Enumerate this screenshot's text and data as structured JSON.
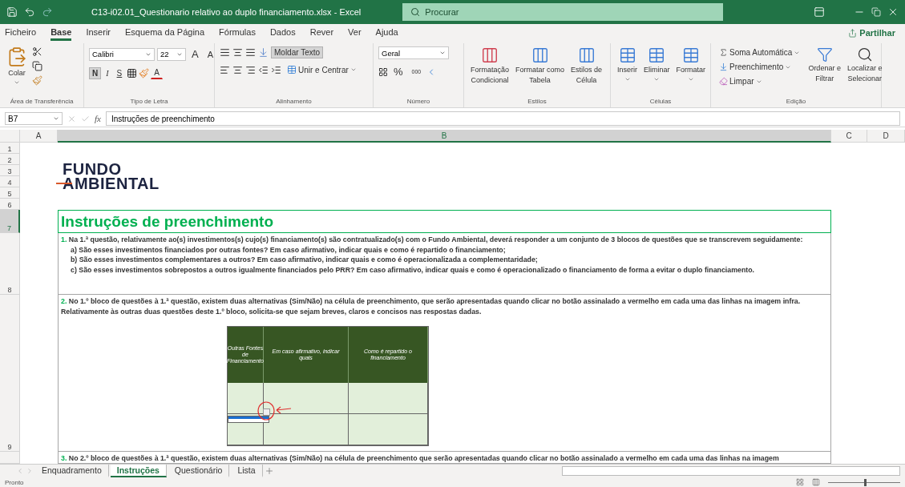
{
  "title_bar": {
    "filename": "C13-i02.01_Questionario relativo ao duplo financiamento.xlsx  -  Excel",
    "search_placeholder": "Procurar"
  },
  "menu_tabs": [
    {
      "label": "Ficheiro",
      "selected": false
    },
    {
      "label": "Base",
      "selected": true
    },
    {
      "label": "Inserir",
      "selected": false
    },
    {
      "label": "Esquema da Página",
      "selected": false
    },
    {
      "label": "Fórmulas",
      "selected": false
    },
    {
      "label": "Dados",
      "selected": false
    },
    {
      "label": "Rever",
      "selected": false
    },
    {
      "label": "Ver",
      "selected": false
    },
    {
      "label": "Ajuda",
      "selected": false
    }
  ],
  "share_button": "Partilhar",
  "ribbon": {
    "clipboard": {
      "paste": "Colar",
      "label": "Área de Transferência"
    },
    "font": {
      "name": "Calibri",
      "size": "22",
      "grow": "A",
      "shrink": "A",
      "bold": "N",
      "italic": "I",
      "underline": "S",
      "color_letter": "A",
      "bold_on": true,
      "label": "Tipo de Letra"
    },
    "alignment": {
      "wrap_text": "Moldar Texto",
      "merge": "Unir e Centrar",
      "wrap_on": true,
      "label": "Alinhamento"
    },
    "number": {
      "format": "Geral",
      "percent": "%",
      "thousands": "000",
      "label": "Número"
    },
    "styles": {
      "buttons": [
        {
          "line1": "Formatação",
          "line2": "Condicional"
        },
        {
          "line1": "Formatar como",
          "line2": "Tabela"
        },
        {
          "line1": "Estilos de",
          "line2": "Célula"
        }
      ],
      "label": "Estilos"
    },
    "cells": {
      "buttons": [
        "Inserir",
        "Eliminar",
        "Formatar"
      ],
      "label": "Células"
    },
    "editing": {
      "autosum": "Soma Automática",
      "fill": "Preenchimento",
      "clear": "Limpar",
      "sort": {
        "line1": "Ordenar e",
        "line2": "Filtrar"
      },
      "find": {
        "line1": "Localizar e",
        "line2": "Selecionar"
      },
      "label": "Edição"
    }
  },
  "formula_bar": {
    "name_box": "B7",
    "fx": "fx",
    "value": "Instruções de preenchimento"
  },
  "columns": [
    {
      "label": "A",
      "selected": false
    },
    {
      "label": "B",
      "selected": true
    },
    {
      "label": "C",
      "selected": false
    },
    {
      "label": "D",
      "selected": false
    }
  ],
  "rows": [
    {
      "label": "1",
      "selected": false
    },
    {
      "label": "2",
      "selected": false
    },
    {
      "label": "3",
      "selected": false
    },
    {
      "label": "4",
      "selected": false
    },
    {
      "label": "5",
      "selected": false
    },
    {
      "label": "6",
      "selected": false
    },
    {
      "label": "7",
      "selected": true
    },
    {
      "label": "8",
      "selected": false
    },
    {
      "label": "9",
      "selected": false
    }
  ],
  "logo": {
    "line1": "FUNDO",
    "line2": "AMBIENTAL"
  },
  "heading": "Instruções de preenchimento",
  "paragraphs": [
    {
      "number": "1.",
      "text": "Na 1.ª questão, relativamente ao(s) investimentos(s) cujo(s) financiamento(s) são contratualizado(s) com o Fundo Ambiental, deverá responder a um conjunto de 3 blocos de questões que se transcrevem seguidamente:",
      "items": [
        "a) São esses investimentos financiados por outras fontes? Em caso afirmativo, indicar quais e como é repartido o financiamento;",
        "b) São esses investimentos complementares a outros? Em caso afirmativo, indicar quais e como é operacionalizada a complementaridade;",
        "c) São esses investimentos sobrepostos a outros igualmente financiados pelo PRR? Em caso afirmativo, indicar quais e como é operacionalizado o financiamento de forma a evitar o duplo financiamento."
      ]
    },
    {
      "number": "2.",
      "text": "No 1.º bloco de questões à 1.ª questão, existem duas alternativas (Sim/Não) na célula de preenchimento, que serão apresentadas quando clicar no botão assinalado a vermelho em cada uma das linhas na imagem infra. Relativamente às outras duas questões deste 1.º bloco, solicita-se que sejam breves, claros e concisos nas respostas dadas.",
      "figure": {
        "headers": [
          "Outras Fontes de Financiamento",
          "Em caso afirmativo, indicar quais",
          "Como é repartido o financiamento"
        ],
        "dropdown_open": true
      }
    },
    {
      "number": "3.",
      "text": "No 2.º bloco de questões à 1.ª questão, existem duas alternativas (Sim/Não) na célula de preenchimento que serão apresentadas quando clicar no botão assinalado a vermelho em cada uma das linhas  na imagem"
    }
  ],
  "sheet_tabs": [
    {
      "label": "Enquadramento",
      "selected": false
    },
    {
      "label": "Instruções",
      "selected": true
    },
    {
      "label": "Questionário",
      "selected": false
    },
    {
      "label": "Lista",
      "selected": false
    }
  ],
  "status": "Pronto",
  "zoom_slider": {
    "level": 0.5
  }
}
